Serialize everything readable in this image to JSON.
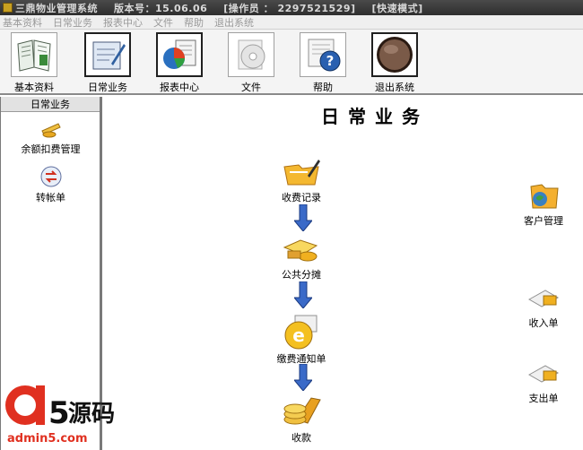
{
  "titlebar": {
    "app_name": "三鼎物业管理系统",
    "version": "版本号：15.06.06",
    "operator": "[操作员 ： 2297521529]",
    "mode": "[快速模式]"
  },
  "menu": {
    "items": [
      "基本资料",
      "日常业务",
      "报表中心",
      "文件",
      "帮助",
      "退出系统"
    ]
  },
  "toolbar": {
    "items": [
      {
        "label": "基本资料",
        "icon": "book-icon"
      },
      {
        "label": "日常业务",
        "icon": "notepad-pen-icon"
      },
      {
        "label": "报表中心",
        "icon": "pie-chart-icon"
      },
      {
        "label": "文件",
        "icon": "cd-disk-icon"
      },
      {
        "label": "帮助",
        "icon": "help-icon"
      },
      {
        "label": "退出系统",
        "icon": "exit-orb-icon"
      }
    ]
  },
  "sidebar": {
    "header": "日常业务",
    "items": [
      {
        "label": "余额扣费管理",
        "icon": "coins-icon"
      },
      {
        "label": "转帐单",
        "icon": "transfer-icon"
      }
    ]
  },
  "main": {
    "title": "日常业务",
    "flow": [
      {
        "label": "收费记录",
        "icon": "folder-pen-icon"
      },
      {
        "label": "公共分摊",
        "icon": "share-money-icon"
      },
      {
        "label": "缴费通知单",
        "icon": "e-notice-icon"
      },
      {
        "label": "收款",
        "icon": "coins-stack-icon"
      }
    ],
    "right": [
      {
        "label": "客户管理",
        "icon": "customer-folder-icon"
      },
      {
        "label": "收入单",
        "icon": "income-card-icon"
      },
      {
        "label": "支出单",
        "icon": "expense-card-icon"
      }
    ]
  },
  "watermark": {
    "logo_text": "a5源码",
    "url": "admin5.com"
  }
}
